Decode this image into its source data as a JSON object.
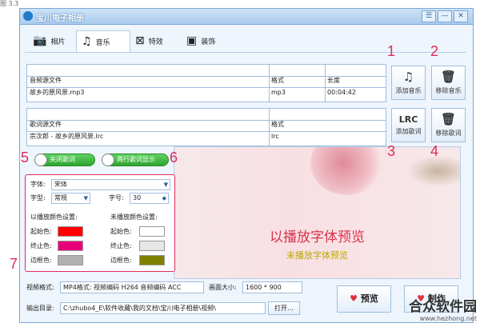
{
  "top_caption": "图 3.3",
  "window": {
    "title": "宝川电子相册"
  },
  "title_buttons": {
    "menu": "☰",
    "min": "—",
    "close": "✕"
  },
  "tabs": [
    {
      "label": "相片",
      "icon": "camera-icon"
    },
    {
      "label": "音乐",
      "icon": "music-note-icon"
    },
    {
      "label": "特效",
      "icon": "effects-icon"
    },
    {
      "label": "装饰",
      "icon": "picture-icon"
    }
  ],
  "music_table": {
    "headers": [
      "音频源文件",
      "格式",
      "长度"
    ],
    "rows": [
      [
        "故乡的原风景.mp3",
        "mp3",
        "00:04:42"
      ]
    ]
  },
  "lyrics_table": {
    "headers": [
      "歌词源文件",
      "格式"
    ],
    "rows": [
      [
        "宗次郎 - 故乡的原风景.lrc",
        "lrc"
      ]
    ]
  },
  "buttons": {
    "add_music": "添加音乐",
    "remove_music": "移除音乐",
    "add_lyrics": "添加歌词",
    "remove_lyrics": "移除歌词",
    "lrc_icon_text": "LRC"
  },
  "markers": {
    "n1": "1",
    "n2": "2",
    "n3": "3",
    "n4": "4",
    "n5": "5",
    "n6": "6",
    "n7": "7"
  },
  "toggles": {
    "close_lyrics": "关闭歌词",
    "two_line": "两行歌词显示"
  },
  "font_panel": {
    "font_label": "字体:",
    "font_value": "宋体",
    "style_label": "字型:",
    "style_value": "常规",
    "size_label": "字号:",
    "size_value": "30",
    "played_title": "以播放颜色设置:",
    "unplayed_title": "未播放颜色设置:",
    "start_label": "起始色:",
    "end_label": "终止色:",
    "border_label": "边框色:",
    "played_colors": {
      "start": "#ff0000",
      "end": "#e6007a",
      "border": "#b0b0b0"
    },
    "unplayed_colors": {
      "start": "#ffffff",
      "end": "#e6e6e6",
      "border": "#808000"
    }
  },
  "preview": {
    "played_text": "以播放字体预览",
    "unplayed_text": "未播放字体预览",
    "played_color": "#d8324a",
    "unplayed_color": "#b8a800"
  },
  "bottom": {
    "video_format_label": "视频格式:",
    "video_format_value": "MP4格式: 视频编码 H264 音频编码 ACC",
    "size_label": "画面大小:",
    "size_value": "1600 * 900",
    "output_label": "输出目录:",
    "output_value": "C:\\zhubo4_E\\软件收藏\\我的文档\\宝川电子相册\\视频\\",
    "open_label": "打开…",
    "preview_label": "预览",
    "make_label": "制作"
  },
  "watermark": {
    "name": "合众软件园",
    "url": "www.hezhong.net"
  }
}
